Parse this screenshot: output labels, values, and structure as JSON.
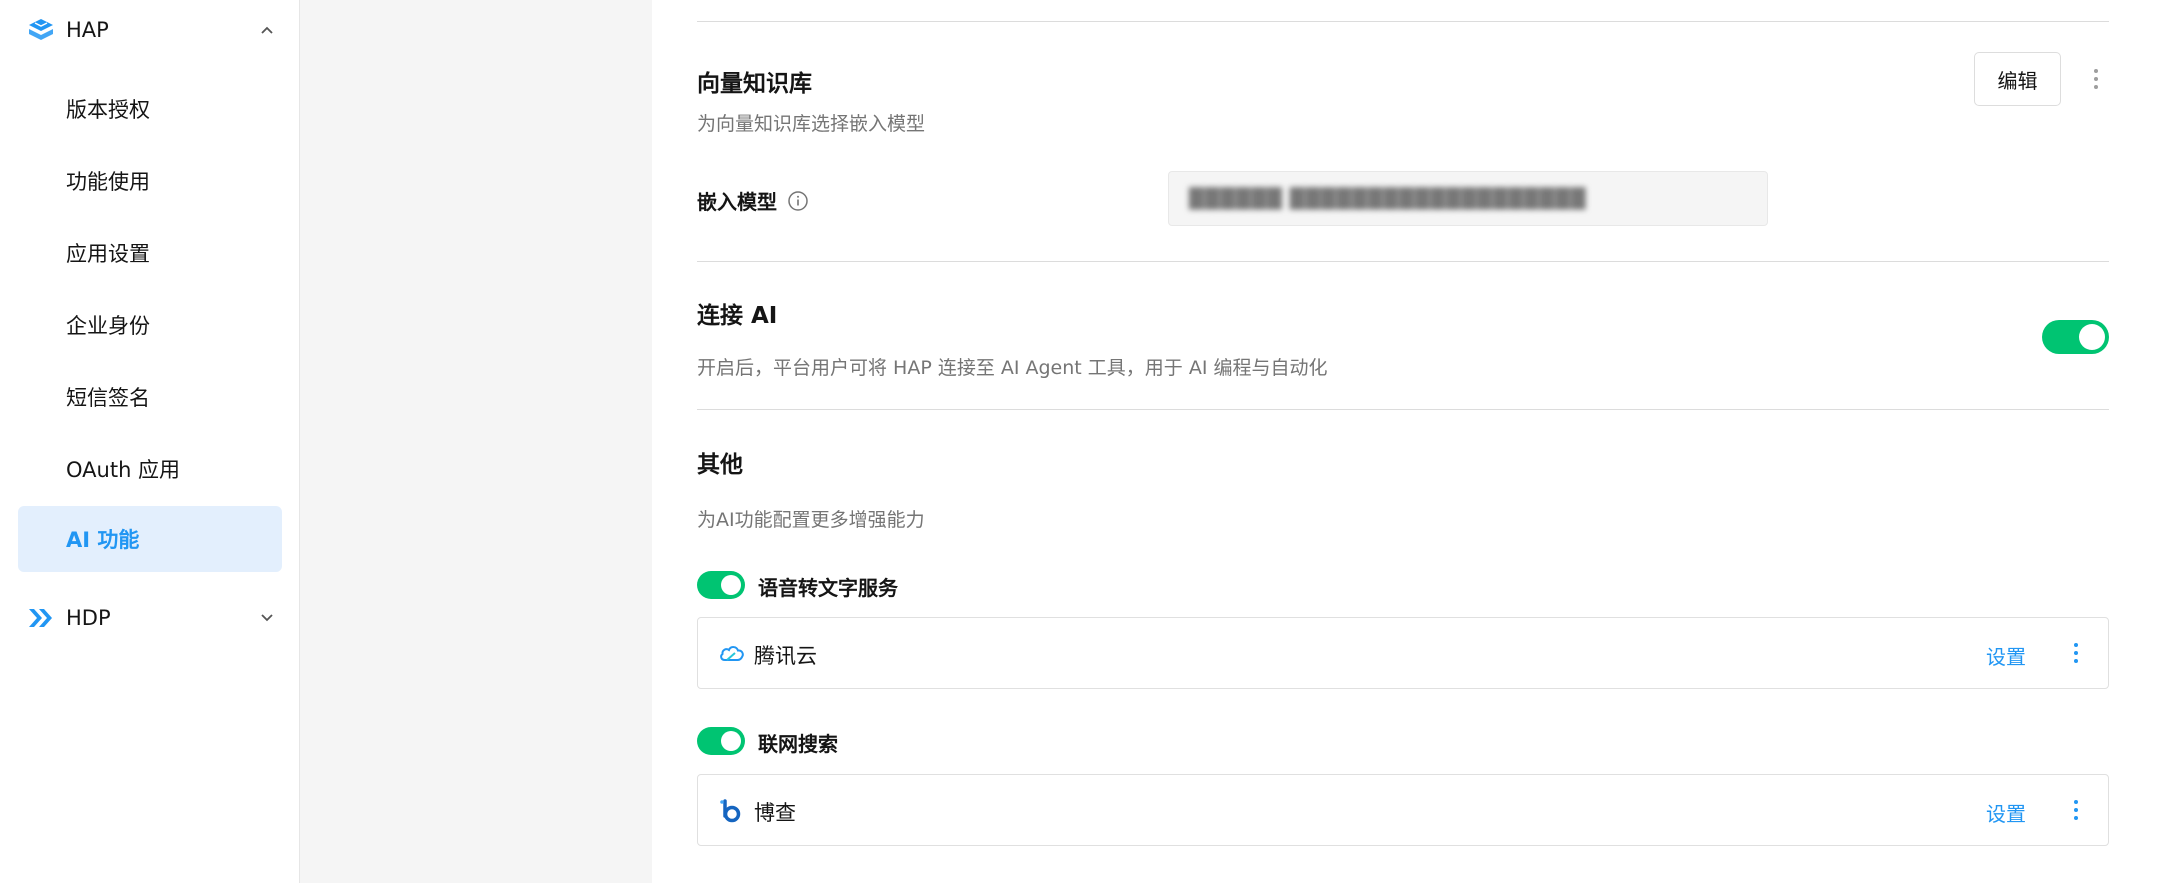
{
  "sidebar": {
    "group_hap": {
      "label": "HAP",
      "expanded": true
    },
    "items": [
      {
        "label": "版本授权"
      },
      {
        "label": "功能使用"
      },
      {
        "label": "应用设置"
      },
      {
        "label": "企业身份"
      },
      {
        "label": "短信签名"
      },
      {
        "label": "OAuth 应用"
      },
      {
        "label": "AI 功能",
        "active": true
      }
    ],
    "group_hdp": {
      "label": "HDP",
      "expanded": false
    }
  },
  "vector_kb": {
    "title": "向量知识库",
    "description": "为向量知识库选择嵌入模型",
    "edit_label": "编辑",
    "embed_label": "嵌入模型",
    "embed_value": "██████ ███████████████████"
  },
  "connect_ai": {
    "title": "连接 AI",
    "description": "开启后，平台用户可将 HAP 连接至 AI Agent 工具，用于 AI 编程与自动化",
    "enabled": true
  },
  "others": {
    "title": "其他",
    "description": "为AI功能配置更多增强能力",
    "services": [
      {
        "label": "语音转文字服务",
        "enabled": true,
        "provider": "腾讯云",
        "icon": "tencent-cloud-icon",
        "setting_label": "设置"
      },
      {
        "label": "联网搜索",
        "enabled": true,
        "provider": "博查",
        "icon": "bocha-icon",
        "setting_label": "设置"
      }
    ]
  },
  "colors": {
    "accent": "#2196f3",
    "toggle_on": "#00c472",
    "active_bg": "#e3effd"
  }
}
